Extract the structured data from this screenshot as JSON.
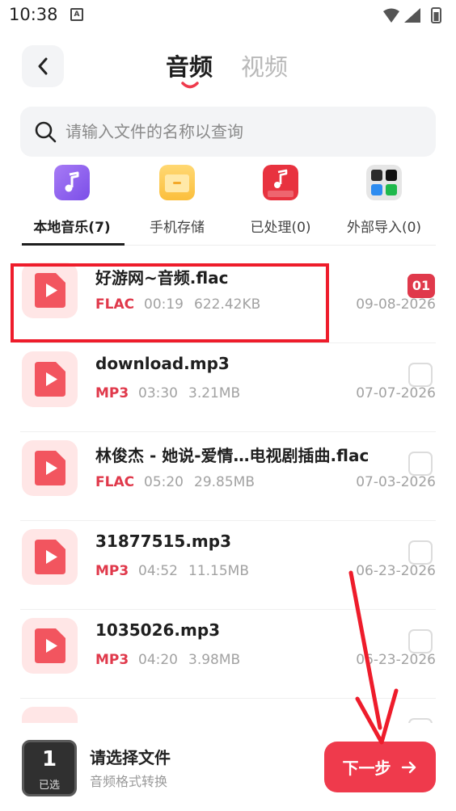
{
  "status_bar": {
    "time": "10:38",
    "indicator": "A"
  },
  "header": {
    "back_icon": "chevron-left-icon",
    "tabs": [
      {
        "label": "音频",
        "active": true
      },
      {
        "label": "视频",
        "active": false
      }
    ]
  },
  "search": {
    "placeholder": "请输入文件的名称以查询",
    "value": ""
  },
  "source_tabs": [
    {
      "label": "本地音乐(7)",
      "icon": "music-note-icon",
      "active": true
    },
    {
      "label": "手机存储",
      "icon": "folder-icon",
      "active": false
    },
    {
      "label": "已处理(0)",
      "icon": "mp3-converted-icon",
      "active": false
    },
    {
      "label": "外部导入(0)",
      "icon": "app-grid-icon",
      "active": false
    }
  ],
  "files": [
    {
      "name": "好游网~音频.flac",
      "format": "FLAC",
      "duration": "00:19",
      "size": "622.42KB",
      "date": "09-08-2026",
      "selected_index": "01"
    },
    {
      "name": "download.mp3",
      "format": "MP3",
      "duration": "03:30",
      "size": "3.21MB",
      "date": "07-07-2026",
      "selected_index": ""
    },
    {
      "name": "林俊杰 - 她说-爱情…电视剧插曲.flac",
      "format": "FLAC",
      "duration": "05:20",
      "size": "29.85MB",
      "date": "07-03-2026",
      "selected_index": ""
    },
    {
      "name": "31877515.mp3",
      "format": "MP3",
      "duration": "04:52",
      "size": "11.15MB",
      "date": "06-23-2026",
      "selected_index": ""
    },
    {
      "name": "1035026.mp3",
      "format": "MP3",
      "duration": "04:20",
      "size": "3.98MB",
      "date": "06-23-2026",
      "selected_index": ""
    }
  ],
  "bottom": {
    "selected_count": "1",
    "selected_label": "已选",
    "title": "请选择文件",
    "subtitle": "音频格式转换",
    "next_label": "下一步"
  },
  "colors": {
    "accent": "#ef3a4c",
    "format": "#e0394b",
    "highlight": "#ee1c2b"
  }
}
